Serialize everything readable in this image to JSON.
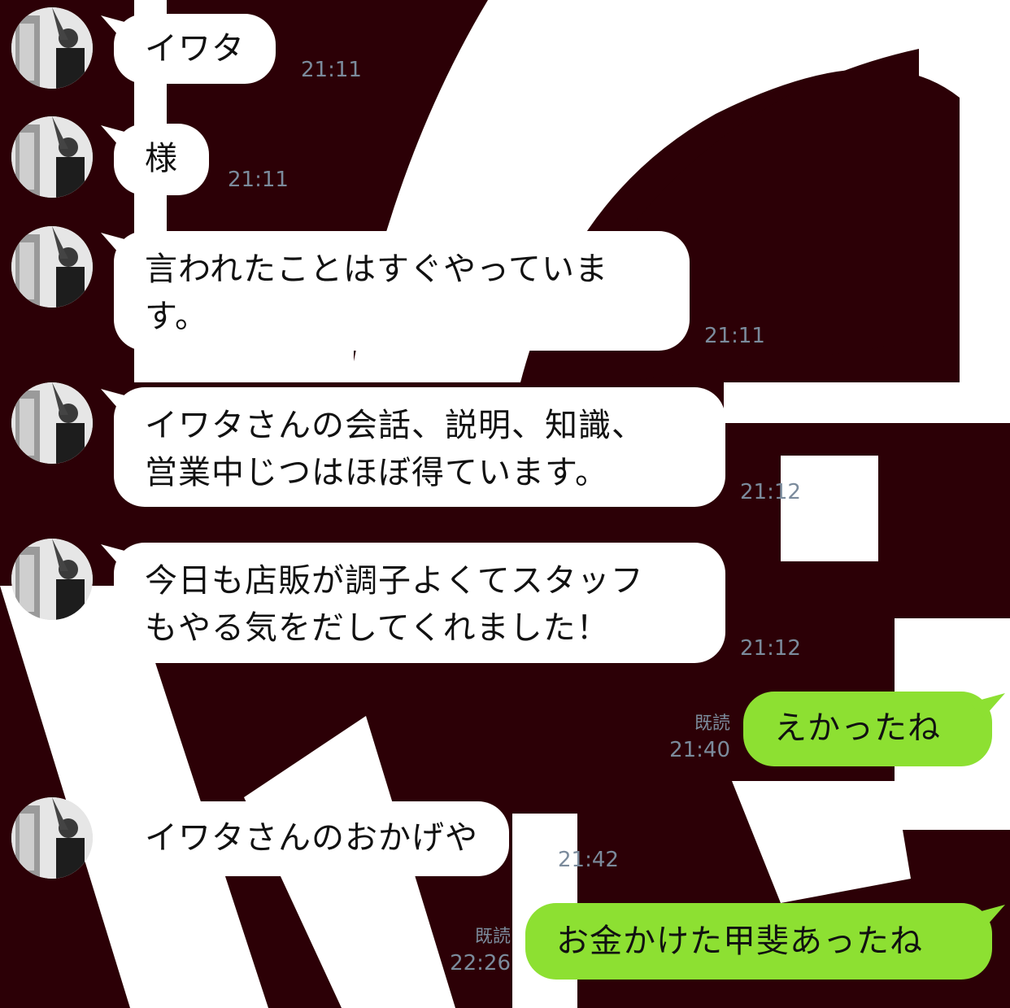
{
  "chat": {
    "messages": [
      {
        "sender": "other",
        "text": [
          "イワタ"
        ],
        "time": "21:11"
      },
      {
        "sender": "other",
        "text": [
          "様"
        ],
        "time": "21:11"
      },
      {
        "sender": "other",
        "text": [
          "言われたことはすぐやっていま",
          "す。"
        ],
        "time": "21:11"
      },
      {
        "sender": "other",
        "text": [
          "イワタさんの会話、説明、知識、",
          "営業中じつはほぼ得ています。"
        ],
        "time": "21:12"
      },
      {
        "sender": "other",
        "text": [
          "今日も店販が調子よくてスタッフ",
          "もやる気をだしてくれました！"
        ],
        "time": "21:12"
      },
      {
        "sender": "me",
        "text": [
          "えかったね"
        ],
        "read": "既読",
        "time": "21:40"
      },
      {
        "sender": "other",
        "text": [
          "イワタさんのおかげや"
        ],
        "time": "21:42"
      },
      {
        "sender": "me",
        "text": [
          "お金かけた甲斐あったね"
        ],
        "read": "既読",
        "time": "22:26"
      }
    ]
  },
  "colors": {
    "background": "#2c0006",
    "incoming_bubble": "#ffffff",
    "outgoing_bubble": "#8de032",
    "timestamp": "#7b8b9c"
  },
  "icons": {
    "avatar": "contact-avatar-photo"
  }
}
